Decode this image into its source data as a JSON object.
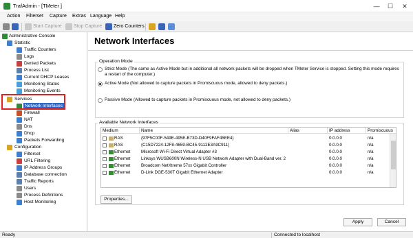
{
  "app": {
    "title": "TrafAdmin - [TMeter ]",
    "colors": {
      "accent": "#2c67c7",
      "highlight": "#d22222",
      "brand": "#2e8b3a"
    }
  },
  "window_controls": {
    "minimize": "—",
    "maximize": "☐",
    "close": "✕"
  },
  "menu": [
    "Action",
    "Filterset",
    "Capture",
    "Extras",
    "Language",
    "Help"
  ],
  "toolbar": {
    "start_capture": "Start Capture",
    "stop_capture": "Stop Capture",
    "zero_counters": "Zero Counters"
  },
  "tree": {
    "items": [
      {
        "label": "Administrative Console",
        "icon": "console-icon"
      },
      {
        "label": "Statistic",
        "icon": "chart-icon"
      },
      {
        "label": "Traffic Counters",
        "icon": "counter-icon"
      },
      {
        "label": "Logs",
        "icon": "log-icon"
      },
      {
        "label": "Denied Packets",
        "icon": "denied-icon"
      },
      {
        "label": "Process List",
        "icon": "list-icon"
      },
      {
        "label": "Current DHCP Leases",
        "icon": "lease-icon"
      },
      {
        "label": "Monitoring States",
        "icon": "monitor-icon"
      },
      {
        "label": "Monitoring Events",
        "icon": "event-icon"
      },
      {
        "label": "Services",
        "icon": "gear-icon"
      },
      {
        "label": "Network Interfaces",
        "icon": "network-icon"
      },
      {
        "label": "Firewall",
        "icon": "firewall-icon"
      },
      {
        "label": "NAT",
        "icon": "nat-icon"
      },
      {
        "label": "Dns",
        "icon": "dns-icon"
      },
      {
        "label": "Dhcp",
        "icon": "dhcp-icon"
      },
      {
        "label": "Packets Forwarding",
        "icon": "forward-icon"
      },
      {
        "label": "Configuration",
        "icon": "gear-icon"
      },
      {
        "label": "Filterset",
        "icon": "filter-icon"
      },
      {
        "label": "URL Filtering",
        "icon": "url-icon"
      },
      {
        "label": "IP Address Groups",
        "icon": "group-icon"
      },
      {
        "label": "Database connection",
        "icon": "database-icon"
      },
      {
        "label": "Traffic Reports",
        "icon": "report-icon"
      },
      {
        "label": "Users",
        "icon": "user-icon"
      },
      {
        "label": "Process Definitions",
        "icon": "process-icon"
      },
      {
        "label": "Host Monitoring",
        "icon": "host-icon"
      }
    ]
  },
  "page": {
    "heading": "Network Interfaces",
    "operation_mode": {
      "title": "Operation Mode",
      "strict": "Strict Mode (The same as Active Mode but in additional all network packets will be dropped when TMeter Service is stopped. Setting this mode requires a restart of the computer.)",
      "active": "Active Mode (Not allowed to capture packets in Promiscuous mode, allowed to deny packets.)",
      "passive": "Passive Mode (Allowed to capture packets in Promiscuous mode, not allowed to deny packets.)",
      "selected": "active"
    },
    "interfaces": {
      "title": "Available Network Interfaces",
      "columns": [
        "Medium",
        "Name",
        "Alias",
        "IP address",
        "Promiscuous"
      ],
      "rows": [
        {
          "medium": "RAS",
          "name": "{97F5C00F-549E-495E-B73D-D40F9FAF45EE4}",
          "alias": "",
          "ip": "0.0.0.0",
          "promisc": "n/a"
        },
        {
          "medium": "RAS",
          "name": "{C15D7224-12F8-4659-BC45-9112E3A9C911}",
          "alias": "",
          "ip": "0.0.0.0",
          "promisc": "n/a"
        },
        {
          "medium": "Ethernet",
          "name": "Microsoft Wi-Fi Direct Virtual Adapter #3",
          "alias": "",
          "ip": "0.0.0.0",
          "promisc": "n/a"
        },
        {
          "medium": "Ethernet",
          "name": "Linksys WUSB600N Wireless-N USB Network Adapter with Dual-Band ver. 2",
          "alias": "",
          "ip": "0.0.0.0",
          "promisc": "n/a"
        },
        {
          "medium": "Ethernet",
          "name": "Broadcom NetXtreme 57xx Gigabit Controller",
          "alias": "",
          "ip": "0.0.0.0",
          "promisc": "n/a"
        },
        {
          "medium": "Ethernet",
          "name": "D-Link DGE-530T Gigabit Ethernet Adapter",
          "alias": "",
          "ip": "0.0.0.0",
          "promisc": "n/a"
        }
      ]
    },
    "properties_button": "Properties...",
    "apply_button": "Apply",
    "cancel_button": "Cancel"
  },
  "status": {
    "left": "Ready",
    "right": "Connected to localhost"
  }
}
